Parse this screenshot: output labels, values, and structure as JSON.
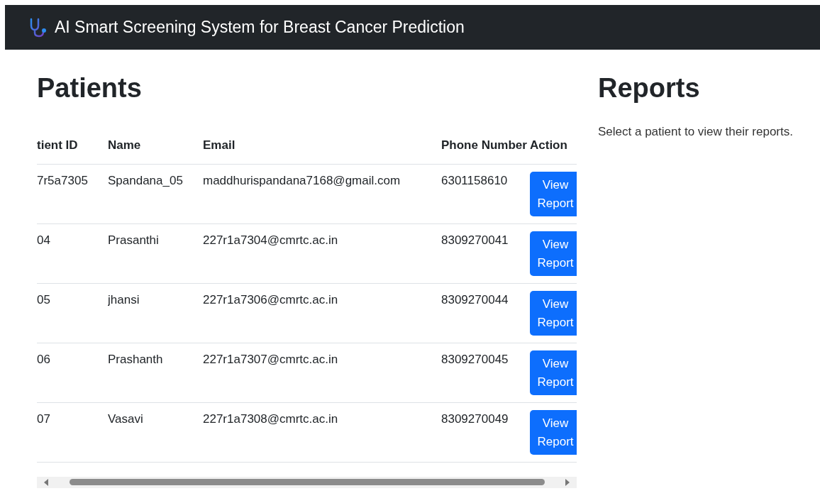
{
  "navbar": {
    "title": "AI Smart Screening System for Breast Cancer Prediction"
  },
  "patients": {
    "heading": "Patients",
    "table": {
      "columns": [
        "tient ID",
        "Name",
        "Email",
        "Phone Number",
        "Action"
      ],
      "rows": [
        {
          "cells": [
            "7r5a7305",
            "Spandana_05",
            "maddhurispandana7168@gmail.com",
            "6301158610"
          ],
          "action": "View Report"
        },
        {
          "cells": [
            "04",
            "Prasanthi",
            "227r1a7304@cmrtc.ac.in",
            "8309270041"
          ],
          "action": "View Report"
        },
        {
          "cells": [
            "05",
            "jhansi",
            "227r1a7306@cmrtc.ac.in",
            "8309270044"
          ],
          "action": "View Report"
        },
        {
          "cells": [
            "06",
            "Prashanth",
            "227r1a7307@cmrtc.ac.in",
            "8309270045"
          ],
          "action": "View Report"
        },
        {
          "cells": [
            "07",
            "Vasavi",
            "227r1a7308@cmrtc.ac.in",
            "8309270049"
          ],
          "action": "View Report"
        }
      ]
    }
  },
  "reports": {
    "heading": "Reports",
    "message": "Select a patient to view their reports."
  }
}
